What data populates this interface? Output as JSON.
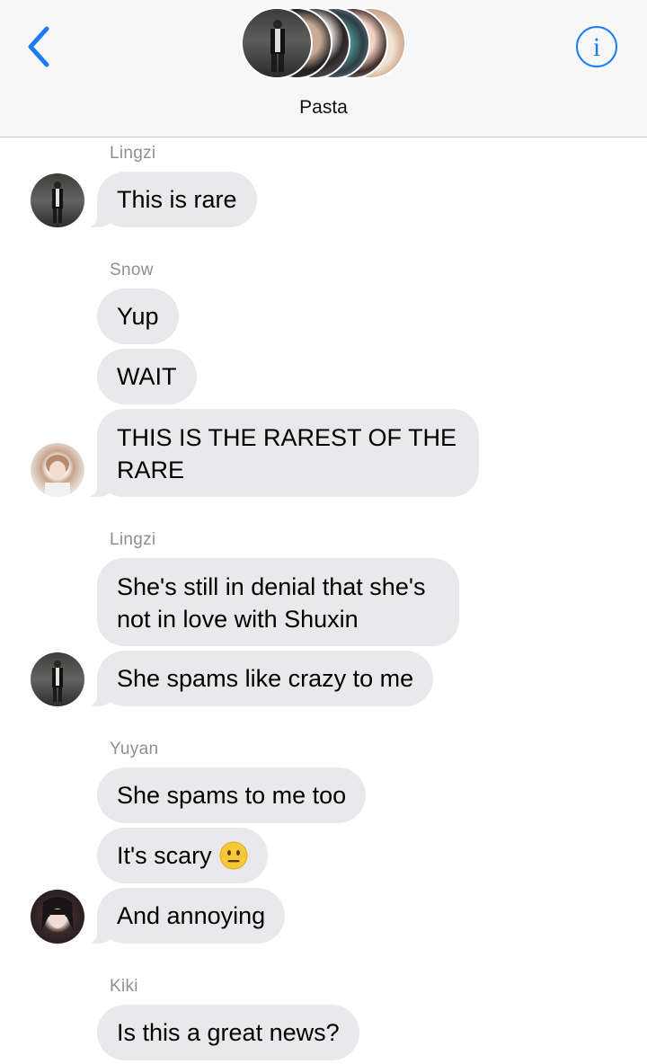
{
  "header": {
    "title": "Pasta",
    "back_icon": "chevron-left-icon",
    "info_icon": "info-icon",
    "info_glyph": "i",
    "accent_color": "#1a7cf5"
  },
  "messages": [
    {
      "sender": "Lingzi",
      "bubbles": [
        "This is rare"
      ]
    },
    {
      "sender": "Snow",
      "bubbles": [
        "Yup",
        "WAIT",
        "THIS IS THE RAREST OF THE RARE"
      ]
    },
    {
      "sender": "Lingzi",
      "bubbles": [
        "She's still in denial that she's not in love with Shuxin",
        "She spams like crazy to me"
      ]
    },
    {
      "sender": "Yuyan",
      "bubbles": [
        "She spams to me too",
        "It's scary",
        "And annoying"
      ],
      "emoji": "neutral-face-icon"
    },
    {
      "sender": "Kiki",
      "bubbles": [
        "Is this a great news?"
      ]
    }
  ],
  "colors": {
    "bubble": "#e9e9eb",
    "sender_name": "#8e8e93",
    "header_bg": "#f7f7f8"
  }
}
